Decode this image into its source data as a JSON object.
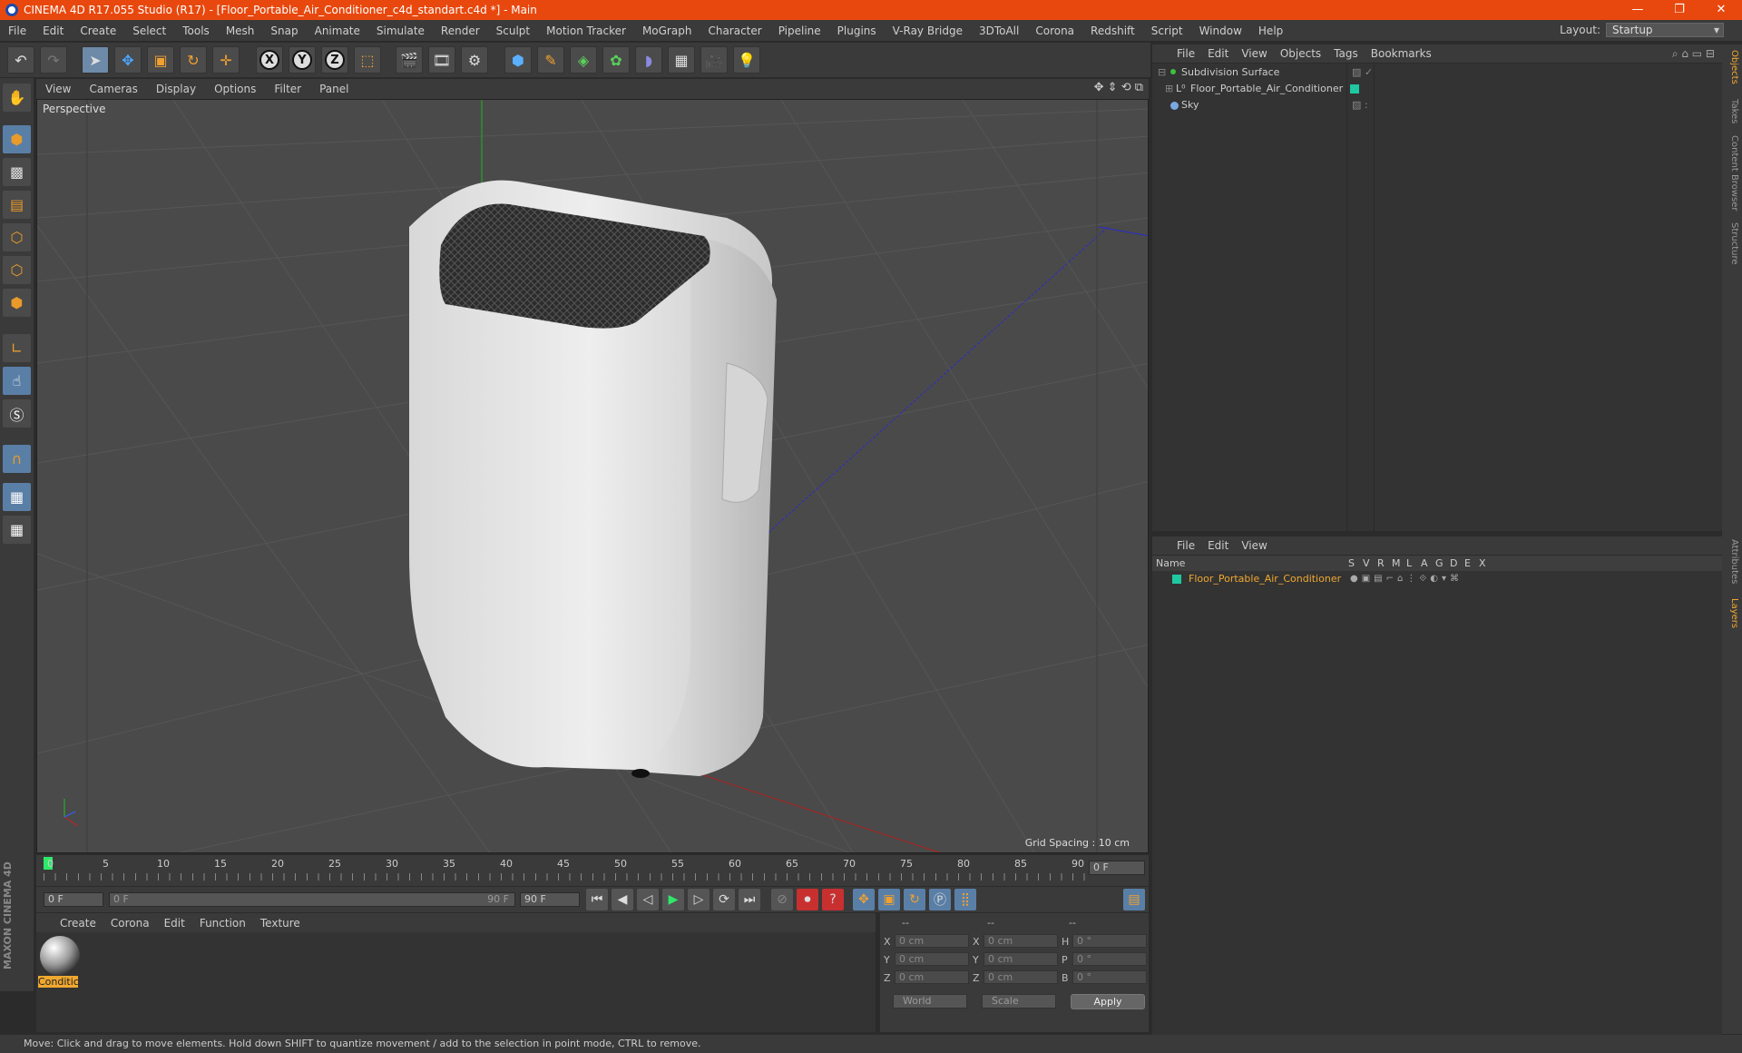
{
  "window": {
    "title": "CINEMA 4D R17.055 Studio (R17) - [Floor_Portable_Air_Conditioner_c4d_standart.c4d *] - Main",
    "minimize": "—",
    "restore": "❐",
    "close": "✕"
  },
  "menu": [
    "File",
    "Edit",
    "Create",
    "Select",
    "Tools",
    "Mesh",
    "Snap",
    "Animate",
    "Simulate",
    "Render",
    "Sculpt",
    "Motion Tracker",
    "MoGraph",
    "Character",
    "Pipeline",
    "Plugins",
    "V-Ray Bridge",
    "3DToAll",
    "Corona",
    "Redshift",
    "Script",
    "Window",
    "Help"
  ],
  "layout": {
    "label": "Layout:",
    "value": "Startup"
  },
  "viewport": {
    "menu": [
      "View",
      "Cameras",
      "Display",
      "Options",
      "Filter",
      "Panel"
    ],
    "camera_label": "Perspective",
    "grid_spacing": "Grid Spacing : 10 cm"
  },
  "timeline": {
    "ticks": [
      "0",
      "5",
      "10",
      "15",
      "20",
      "25",
      "30",
      "35",
      "40",
      "45",
      "50",
      "55",
      "60",
      "65",
      "70",
      "75",
      "80",
      "85",
      "90"
    ],
    "current_frame": "0 F",
    "start_field": "0 F",
    "range_start": "0 F",
    "range_end": "90 F",
    "end_field": "90 F"
  },
  "materials": {
    "menu": [
      "Create",
      "Corona",
      "Edit",
      "Function",
      "Texture"
    ],
    "items": [
      {
        "label": "Conditic"
      }
    ]
  },
  "coordinates": {
    "headers": [
      "--",
      "--",
      "--"
    ],
    "rows": [
      {
        "axis1": "X",
        "val1": "0 cm",
        "axis2": "X",
        "val2": "0 cm",
        "axis3": "H",
        "val3": "0 °"
      },
      {
        "axis1": "Y",
        "val1": "0 cm",
        "axis2": "Y",
        "val2": "0 cm",
        "axis3": "P",
        "val3": "0 °"
      },
      {
        "axis1": "Z",
        "val1": "0 cm",
        "axis2": "Z",
        "val2": "0 cm",
        "axis3": "B",
        "val3": "0 °"
      }
    ],
    "space": "World",
    "mode": "Scale",
    "apply": "Apply"
  },
  "objects": {
    "menu": [
      "File",
      "Edit",
      "View",
      "Objects",
      "Tags",
      "Bookmarks"
    ],
    "items": [
      {
        "name": "Subdivision Surface",
        "color": "#3fbf3f"
      },
      {
        "name": "Floor_Portable_Air_Conditioner",
        "color": "#1fc8a0"
      },
      {
        "name": "Sky",
        "color": "#7aa8e0"
      }
    ]
  },
  "layers": {
    "menu": [
      "File",
      "Edit",
      "View"
    ],
    "columns": [
      "Name",
      "S",
      "V",
      "R",
      "M",
      "L",
      "A",
      "G",
      "D",
      "E",
      "X"
    ],
    "items": [
      {
        "name": "Floor_Portable_Air_Conditioner",
        "color": "#1fc8a0"
      }
    ]
  },
  "right_tabs": [
    "Objects",
    "Takes",
    "Content Browser",
    "Structure",
    "Attributes",
    "Layers"
  ],
  "brand": "MAXON CINEMA 4D",
  "status": "Move: Click and drag to move elements. Hold down SHIFT to quantize movement / add to the selection in point mode, CTRL to remove.",
  "colors": {
    "title_bar": "#e8480e",
    "accent_orange": "#f0a830",
    "layer_name": "#f0a830"
  }
}
